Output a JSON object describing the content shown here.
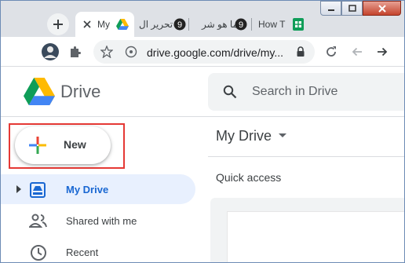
{
  "browser": {
    "tabs": [
      {
        "label": "My",
        "icon": "google-drive-icon"
      },
      {
        "label": "تحرير ال",
        "icon": "circle-9-icon"
      },
      {
        "label": "ما هو شر",
        "icon": "circle-9-icon"
      },
      {
        "label": "How T",
        "icon": "google-sheets-icon"
      }
    ],
    "url": "drive.google.com/drive/my..."
  },
  "drive": {
    "product_name": "Drive",
    "search_placeholder": "Search in Drive",
    "new_button_label": "New",
    "nav": [
      {
        "label": "My Drive",
        "icon": "my-drive-icon",
        "active": true
      },
      {
        "label": "Shared with me",
        "icon": "people-icon",
        "active": false
      },
      {
        "label": "Recent",
        "icon": "clock-icon",
        "active": false
      }
    ],
    "main_title": "My Drive",
    "quick_access_label": "Quick access"
  },
  "colors": {
    "accent": "#1967d2",
    "active_bg": "#e8f0fe",
    "highlight_box": "#e53935"
  }
}
